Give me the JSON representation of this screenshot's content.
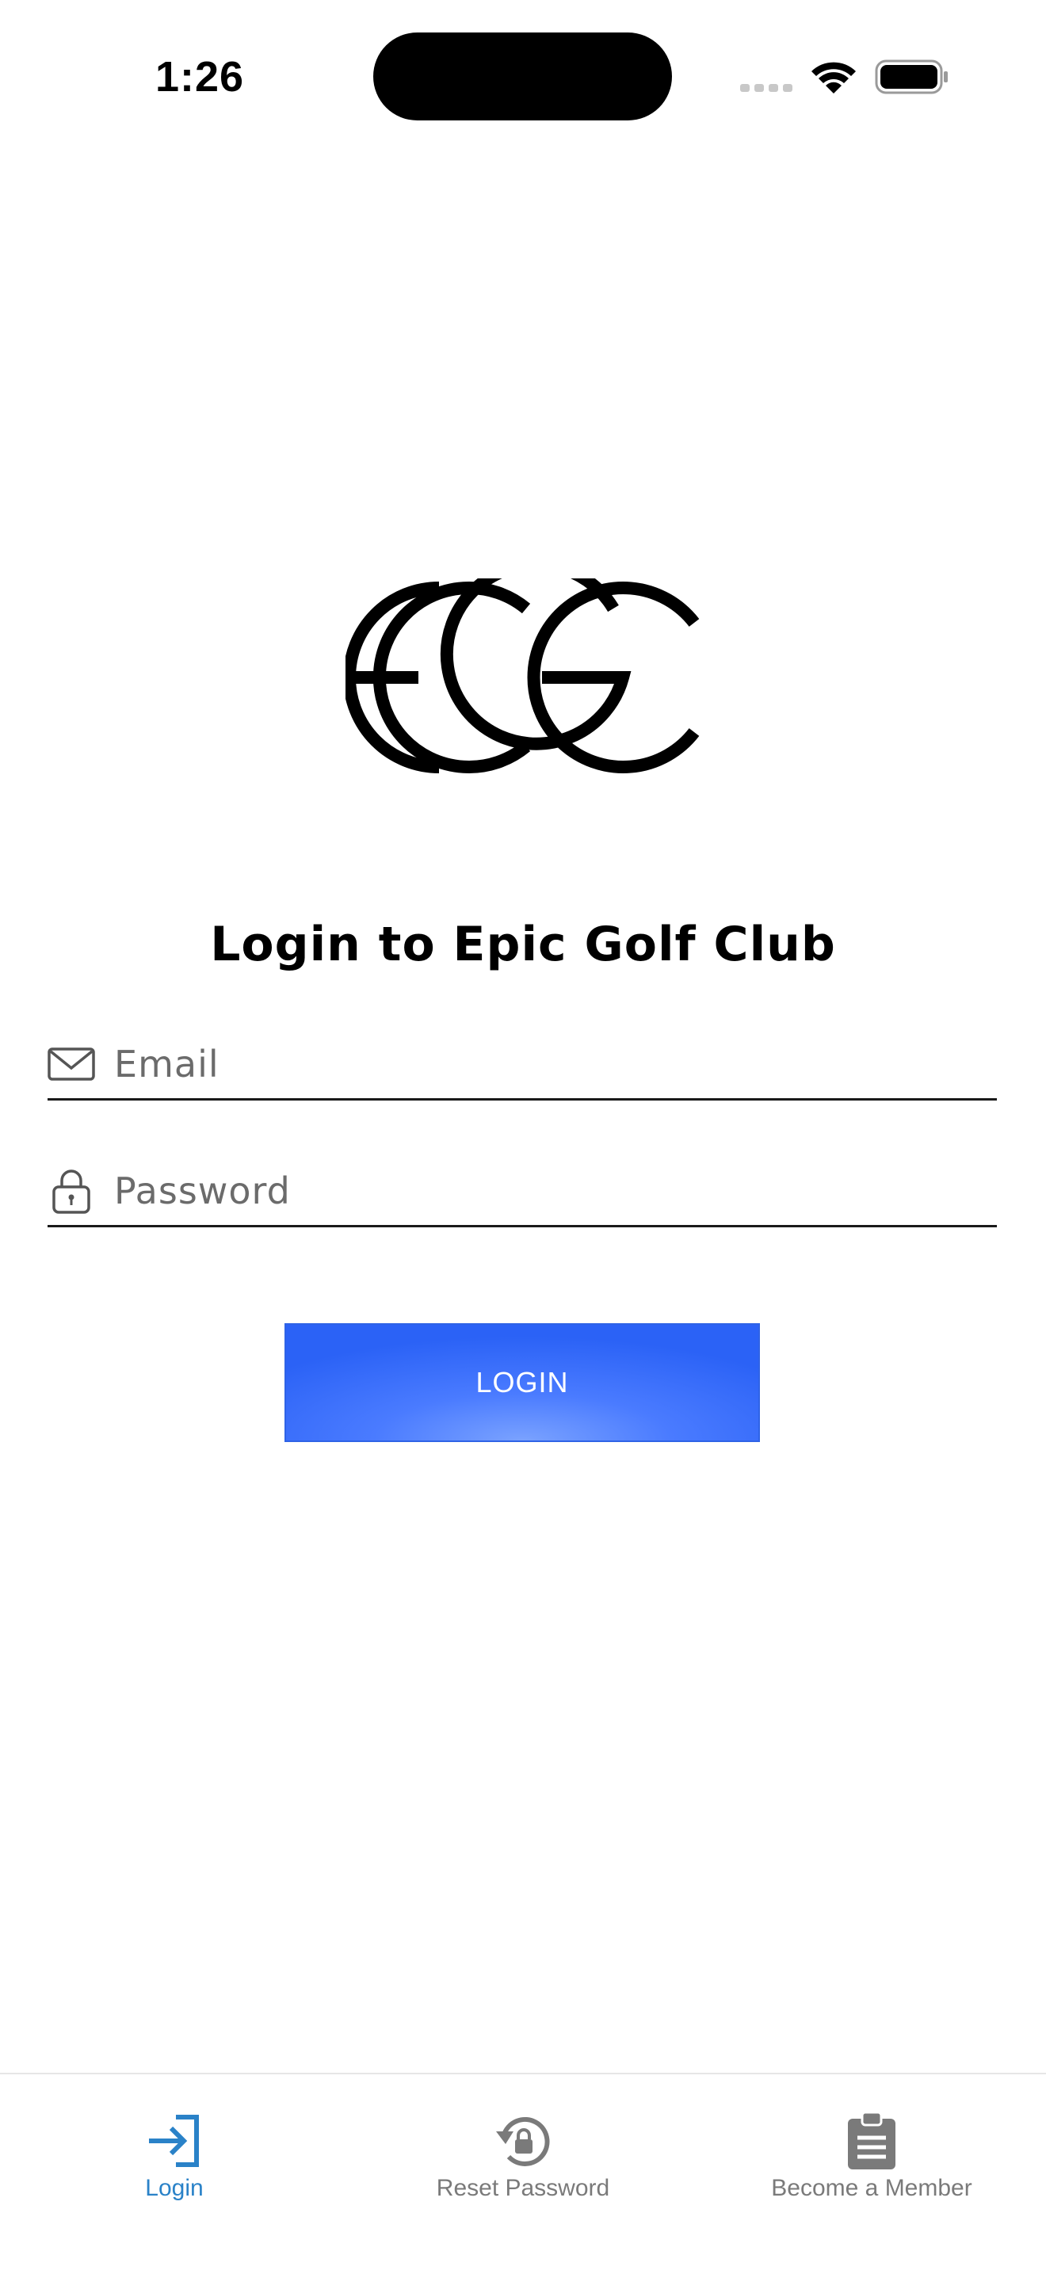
{
  "status_bar": {
    "time": "1:26"
  },
  "logo": {
    "text": "ECGC"
  },
  "title": "Login to Epic Golf Club",
  "form": {
    "email": {
      "value": "",
      "placeholder": "Email",
      "icon": "envelope-icon"
    },
    "password": {
      "value": "",
      "placeholder": "Password",
      "icon": "lock-icon"
    },
    "login_label": "LOGIN"
  },
  "tabs": [
    {
      "label": "Login",
      "icon": "login-arrow-icon",
      "active": true
    },
    {
      "label": "Reset Password",
      "icon": "reset-lock-icon",
      "active": false
    },
    {
      "label": "Become a Member",
      "icon": "clipboard-icon",
      "active": false
    }
  ],
  "colors": {
    "accent": "#2a82c8",
    "button": "#3a6ef8",
    "inactive_tab": "#7a7a7a"
  }
}
